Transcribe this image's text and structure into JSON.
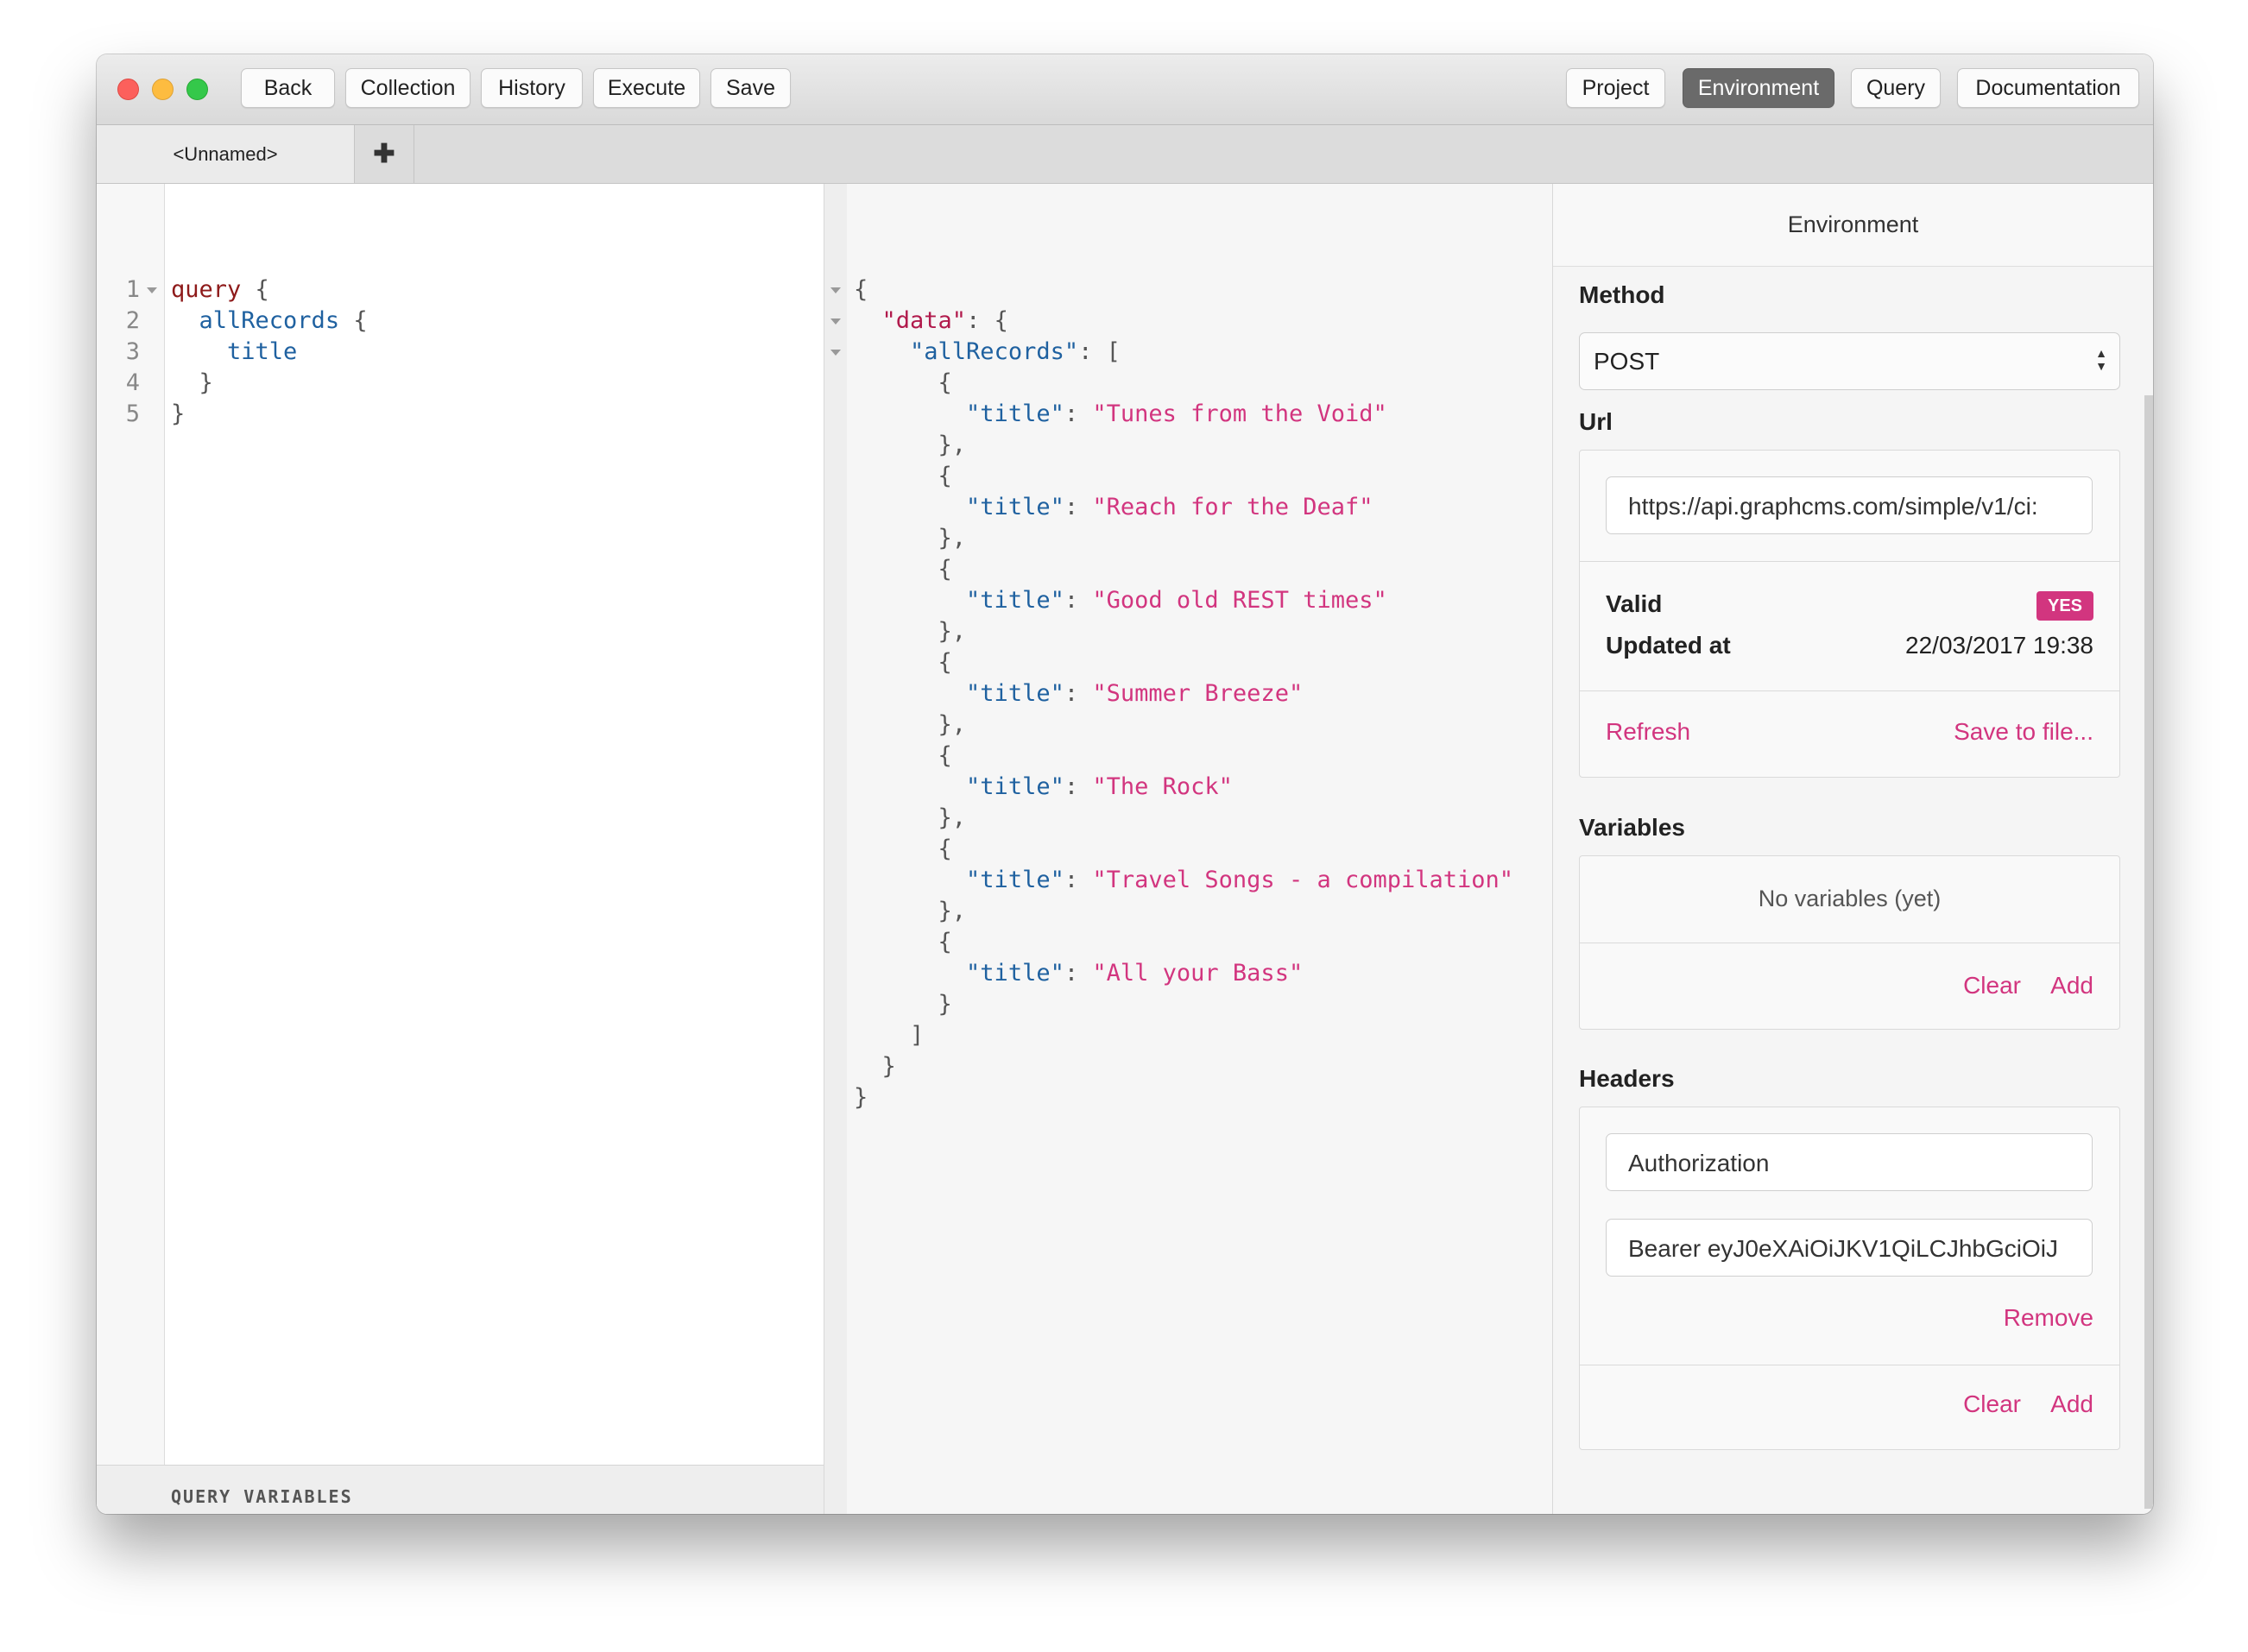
{
  "toolbar": {
    "left_buttons": [
      "Back",
      "Collection",
      "History",
      "Execute",
      "Save"
    ],
    "right_buttons": [
      "Project",
      "Environment",
      "Query",
      "Documentation"
    ],
    "active": "Environment"
  },
  "tabs": {
    "active_tab": "<Unnamed>",
    "add_icon": "plus-icon"
  },
  "query_editor": {
    "line_numbers": [
      "1",
      "2",
      "3",
      "4",
      "5"
    ],
    "variables_label": "QUERY VARIABLES"
  },
  "result": {
    "titles": [
      "Tunes from the Void",
      "Reach for the Deaf",
      "Good old REST times",
      "Summer Breeze",
      "The Rock",
      "Travel Songs - a compilation",
      "All your Bass"
    ]
  },
  "environment": {
    "title": "Environment",
    "method": {
      "label": "Method",
      "value": "POST"
    },
    "url": {
      "label": "Url",
      "value": "https://api.graphcms.com/simple/v1/ci:",
      "valid_label": "Valid",
      "valid_value": "YES",
      "updated_label": "Updated at",
      "updated_value": "22/03/2017 19:38",
      "refresh": "Refresh",
      "save": "Save to file..."
    },
    "variables": {
      "label": "Variables",
      "empty": "No variables (yet)",
      "clear": "Clear",
      "add": "Add"
    },
    "headers": {
      "label": "Headers",
      "name": "Authorization",
      "value": "Bearer eyJ0eXAiOiJKV1QiLCJhbGciOiJ",
      "remove": "Remove",
      "clear": "Clear",
      "add": "Add"
    }
  },
  "colors": {
    "accent": "#d2357f",
    "keyword": "#8e1a1a",
    "field": "#1f61a0"
  }
}
